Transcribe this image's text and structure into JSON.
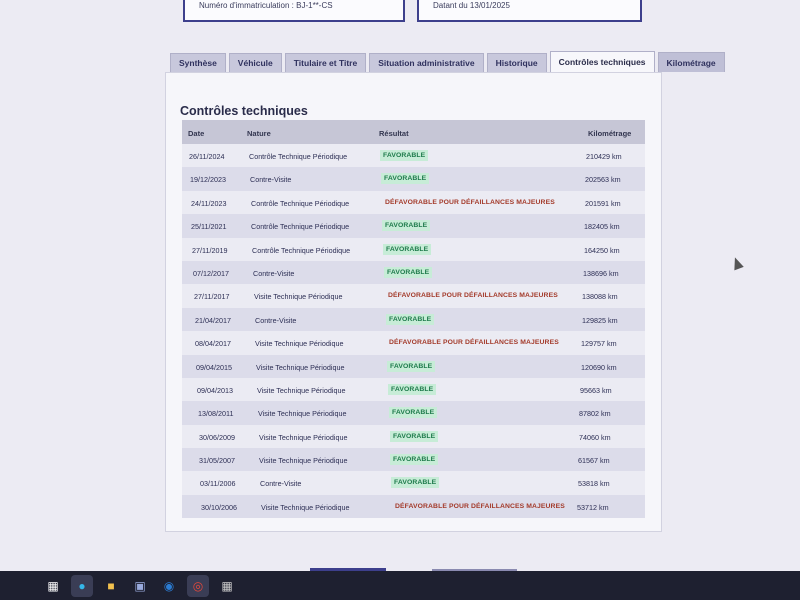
{
  "header": {
    "registration_label": "Numéro d'immatriculation : BJ-1**-CS",
    "date_label": "Datant du 13/01/2025"
  },
  "tabs": [
    {
      "label": "Synthèse"
    },
    {
      "label": "Véhicule"
    },
    {
      "label": "Titulaire et Titre"
    },
    {
      "label": "Situation administrative"
    },
    {
      "label": "Historique"
    },
    {
      "label": "Contrôles techniques"
    },
    {
      "label": "Kilométrage"
    }
  ],
  "section_title": "Contrôles techniques",
  "table": {
    "columns": [
      "Date",
      "Nature",
      "Résultat",
      "Kilométrage"
    ],
    "rows": [
      {
        "date": "26/11/2024",
        "nature": "Contrôle Technique Périodique",
        "result": "FAVORABLE",
        "km": "210429 km"
      },
      {
        "date": "19/12/2023",
        "nature": "Contre-Visite",
        "result": "FAVORABLE",
        "km": "202563 km"
      },
      {
        "date": "24/11/2023",
        "nature": "Contrôle Technique Périodique",
        "result": "DÉFAVORABLE POUR DÉFAILLANCES MAJEURES",
        "km": "201591 km"
      },
      {
        "date": "25/11/2021",
        "nature": "Contrôle Technique Périodique",
        "result": "FAVORABLE",
        "km": "182405 km"
      },
      {
        "date": "27/11/2019",
        "nature": "Contrôle Technique Périodique",
        "result": "FAVORABLE",
        "km": "164250 km"
      },
      {
        "date": "07/12/2017",
        "nature": "Contre-Visite",
        "result": "FAVORABLE",
        "km": "138696 km"
      },
      {
        "date": "27/11/2017",
        "nature": "Visite Technique Périodique",
        "result": "DÉFAVORABLE POUR DÉFAILLANCES MAJEURES",
        "km": "138088 km"
      },
      {
        "date": "21/04/2017",
        "nature": "Contre-Visite",
        "result": "FAVORABLE",
        "km": "129825 km"
      },
      {
        "date": "08/04/2017",
        "nature": "Visite Technique Périodique",
        "result": "DÉFAVORABLE POUR DÉFAILLANCES MAJEURES",
        "km": "129757 km"
      },
      {
        "date": "09/04/2015",
        "nature": "Visite Technique Périodique",
        "result": "FAVORABLE",
        "km": "120690 km"
      },
      {
        "date": "09/04/2013",
        "nature": "Visite Technique Périodique",
        "result": "FAVORABLE",
        "km": "95663 km"
      },
      {
        "date": "13/08/2011",
        "nature": "Visite Technique Périodique",
        "result": "FAVORABLE",
        "km": "87802 km"
      },
      {
        "date": "30/06/2009",
        "nature": "Visite Technique Périodique",
        "result": "FAVORABLE",
        "km": "74060 km"
      },
      {
        "date": "31/05/2007",
        "nature": "Visite Technique Périodique",
        "result": "FAVORABLE",
        "km": "61567 km"
      },
      {
        "date": "03/11/2006",
        "nature": "Contre-Visite",
        "result": "FAVORABLE",
        "km": "53818 km"
      },
      {
        "date": "30/10/2006",
        "nature": "Visite Technique Périodique",
        "result": "DÉFAVORABLE POUR DÉFAILLANCES MAJEURES",
        "km": "53712 km"
      }
    ]
  },
  "taskbar": {
    "icons": [
      "task-view-icon",
      "edge-browser-icon",
      "file-explorer-icon",
      "store-icon",
      "outlook-icon",
      "chrome-icon",
      "calculator-icon"
    ]
  },
  "colors": {
    "favorable_bg": "#c7ecd7",
    "favorable_text": "#1d7a4a",
    "defavorable_text": "#a33a2a",
    "accent": "#3d3f8c"
  }
}
